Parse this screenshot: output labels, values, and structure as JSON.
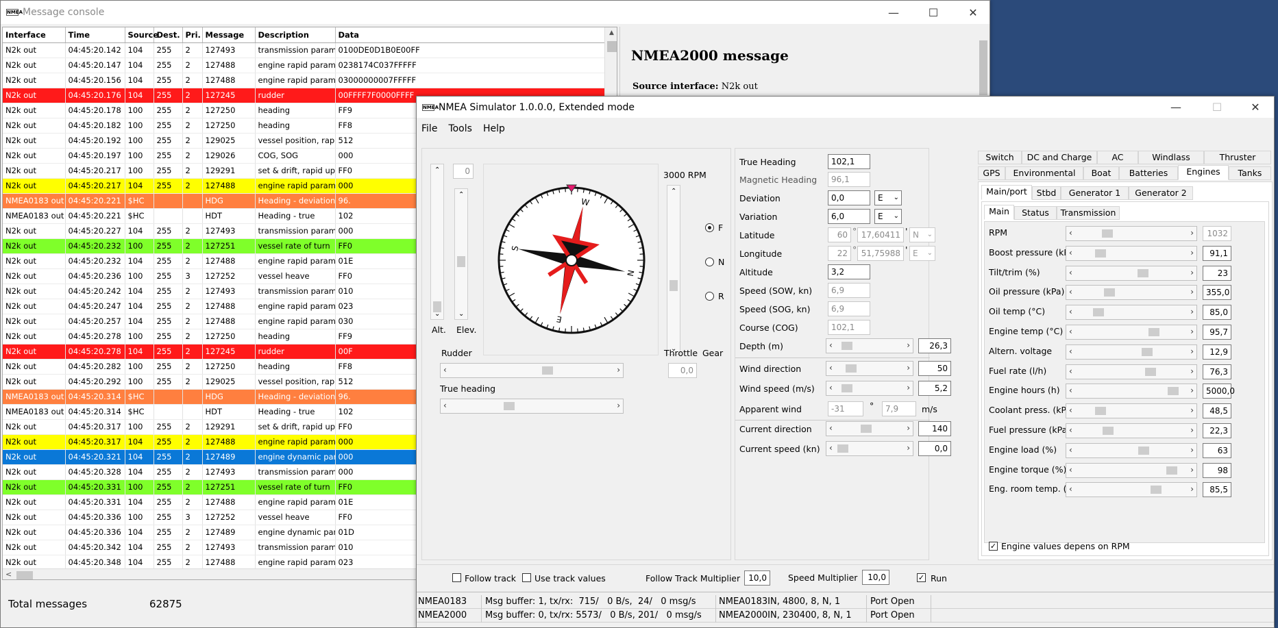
{
  "console": {
    "title": "Message console",
    "columns": [
      "Interface",
      "Time",
      "Source",
      "Dest.",
      "Pri.",
      "Message",
      "Description",
      "Data"
    ],
    "rows": [
      {
        "c": [
          "N2k out",
          "04:45:20.142",
          "104",
          "255",
          "2",
          "127493",
          "transmission parameter",
          "0100DE0D1B0E00FF"
        ],
        "hl": ""
      },
      {
        "c": [
          "N2k out",
          "04:45:20.147",
          "104",
          "255",
          "2",
          "127488",
          "engine rapid parameter",
          "0238174C037FFFFF"
        ],
        "hl": ""
      },
      {
        "c": [
          "N2k out",
          "04:45:20.156",
          "104",
          "255",
          "2",
          "127488",
          "engine rapid parameter",
          "03000000007FFFFF"
        ],
        "hl": ""
      },
      {
        "c": [
          "N2k out",
          "04:45:20.176",
          "104",
          "255",
          "2",
          "127245",
          "rudder",
          "00FFFF7F0000FFFF"
        ],
        "hl": "red"
      },
      {
        "c": [
          "N2k out",
          "04:45:20.178",
          "100",
          "255",
          "2",
          "127250",
          "heading",
          "FF9"
        ],
        "hl": ""
      },
      {
        "c": [
          "N2k out",
          "04:45:20.182",
          "100",
          "255",
          "2",
          "127250",
          "heading",
          "FF8"
        ],
        "hl": ""
      },
      {
        "c": [
          "N2k out",
          "04:45:20.192",
          "100",
          "255",
          "2",
          "129025",
          "vessel position, rapid up",
          "512"
        ],
        "hl": ""
      },
      {
        "c": [
          "N2k out",
          "04:45:20.197",
          "100",
          "255",
          "2",
          "129026",
          "COG, SOG",
          "000"
        ],
        "hl": ""
      },
      {
        "c": [
          "N2k out",
          "04:45:20.217",
          "100",
          "255",
          "2",
          "129291",
          "set & drift, rapid update",
          "FF0"
        ],
        "hl": ""
      },
      {
        "c": [
          "N2k out",
          "04:45:20.217",
          "104",
          "255",
          "2",
          "127488",
          "engine rapid parameter",
          "000"
        ],
        "hl": "yellow"
      },
      {
        "c": [
          "NMEA0183 out",
          "04:45:20.221",
          "$HC",
          "",
          "",
          "HDG",
          "Heading - deviation & va",
          "96."
        ],
        "hl": "orange"
      },
      {
        "c": [
          "NMEA0183 out",
          "04:45:20.221",
          "$HC",
          "",
          "",
          "HDT",
          "Heading - true",
          "102"
        ],
        "hl": ""
      },
      {
        "c": [
          "N2k out",
          "04:45:20.227",
          "104",
          "255",
          "2",
          "127493",
          "transmission parameter",
          "000"
        ],
        "hl": ""
      },
      {
        "c": [
          "N2k out",
          "04:45:20.232",
          "100",
          "255",
          "2",
          "127251",
          "vessel rate of turn",
          "FF0"
        ],
        "hl": "green"
      },
      {
        "c": [
          "N2k out",
          "04:45:20.232",
          "104",
          "255",
          "2",
          "127488",
          "engine rapid parameter",
          "01E"
        ],
        "hl": ""
      },
      {
        "c": [
          "N2k out",
          "04:45:20.236",
          "100",
          "255",
          "3",
          "127252",
          "vessel heave",
          "FF0"
        ],
        "hl": ""
      },
      {
        "c": [
          "N2k out",
          "04:45:20.242",
          "104",
          "255",
          "2",
          "127493",
          "transmission parameter",
          "010"
        ],
        "hl": ""
      },
      {
        "c": [
          "N2k out",
          "04:45:20.247",
          "104",
          "255",
          "2",
          "127488",
          "engine rapid parameter",
          "023"
        ],
        "hl": ""
      },
      {
        "c": [
          "N2k out",
          "04:45:20.257",
          "104",
          "255",
          "2",
          "127488",
          "engine rapid parameter",
          "030"
        ],
        "hl": ""
      },
      {
        "c": [
          "N2k out",
          "04:45:20.278",
          "100",
          "255",
          "2",
          "127250",
          "heading",
          "FF9"
        ],
        "hl": ""
      },
      {
        "c": [
          "N2k out",
          "04:45:20.278",
          "104",
          "255",
          "2",
          "127245",
          "rudder",
          "00F"
        ],
        "hl": "red"
      },
      {
        "c": [
          "N2k out",
          "04:45:20.282",
          "100",
          "255",
          "2",
          "127250",
          "heading",
          "FF8"
        ],
        "hl": ""
      },
      {
        "c": [
          "N2k out",
          "04:45:20.292",
          "100",
          "255",
          "2",
          "129025",
          "vessel position, rapid up",
          "512"
        ],
        "hl": ""
      },
      {
        "c": [
          "NMEA0183 out",
          "04:45:20.314",
          "$HC",
          "",
          "",
          "HDG",
          "Heading - deviation & va",
          "96."
        ],
        "hl": "orange"
      },
      {
        "c": [
          "NMEA0183 out",
          "04:45:20.314",
          "$HC",
          "",
          "",
          "HDT",
          "Heading - true",
          "102"
        ],
        "hl": ""
      },
      {
        "c": [
          "N2k out",
          "04:45:20.317",
          "100",
          "255",
          "2",
          "129291",
          "set & drift, rapid update",
          "FF0"
        ],
        "hl": ""
      },
      {
        "c": [
          "N2k out",
          "04:45:20.317",
          "104",
          "255",
          "2",
          "127488",
          "engine rapid parameter",
          "000"
        ],
        "hl": "yellow"
      },
      {
        "c": [
          "N2k out",
          "04:45:20.321",
          "104",
          "255",
          "2",
          "127489",
          "engine dynamic parame",
          "000"
        ],
        "hl": "blue"
      },
      {
        "c": [
          "N2k out",
          "04:45:20.328",
          "104",
          "255",
          "2",
          "127493",
          "transmission parameter",
          "000"
        ],
        "hl": ""
      },
      {
        "c": [
          "N2k out",
          "04:45:20.331",
          "100",
          "255",
          "2",
          "127251",
          "vessel rate of turn",
          "FF0"
        ],
        "hl": "green"
      },
      {
        "c": [
          "N2k out",
          "04:45:20.331",
          "104",
          "255",
          "2",
          "127488",
          "engine rapid parameter",
          "01E"
        ],
        "hl": ""
      },
      {
        "c": [
          "N2k out",
          "04:45:20.336",
          "100",
          "255",
          "3",
          "127252",
          "vessel heave",
          "FF0"
        ],
        "hl": ""
      },
      {
        "c": [
          "N2k out",
          "04:45:20.336",
          "104",
          "255",
          "2",
          "127489",
          "engine dynamic parame",
          "01D"
        ],
        "hl": ""
      },
      {
        "c": [
          "N2k out",
          "04:45:20.342",
          "104",
          "255",
          "2",
          "127493",
          "transmission parameter",
          "010"
        ],
        "hl": ""
      },
      {
        "c": [
          "N2k out",
          "04:45:20.348",
          "104",
          "255",
          "2",
          "127488",
          "engine rapid parameter",
          "023"
        ],
        "hl": ""
      }
    ],
    "total_label": "Total messages",
    "total_value": "62875",
    "detail_title": "NMEA2000 message",
    "detail_source_label": "Source interface:",
    "detail_source_value": "N2k out"
  },
  "sim": {
    "title": "NMEA Simulator 1.0.0.0, Extended mode",
    "menu": [
      "File",
      "Tools",
      "Help"
    ],
    "alt_value": "0",
    "alt_label": "Alt.",
    "elev_label": "Elev.",
    "rpm_label": "3000 RPM",
    "gear": [
      "F",
      "N",
      "R"
    ],
    "rudder_label": "Rudder",
    "throttle_label": "Throttle",
    "gear_label": "Gear",
    "throttle_value": "0,0",
    "true_heading_label": "True heading",
    "nav": {
      "true_heading": {
        "label": "True Heading",
        "value": "102,1"
      },
      "magnetic_heading": {
        "label": "Magnetic Heading",
        "value": "96,1"
      },
      "deviation": {
        "label": "Deviation",
        "value": "0,0",
        "dir": "E"
      },
      "variation": {
        "label": "Variation",
        "value": "6,0",
        "dir": "E"
      },
      "latitude": {
        "label": "Latitude",
        "deg": "60",
        "min": "17,60411",
        "dir": "N"
      },
      "longitude": {
        "label": "Longitude",
        "deg": "22",
        "min": "51,75988",
        "dir": "E"
      },
      "degree_sign": "°",
      "minute_sign": "'",
      "altitude": {
        "label": "Altitude",
        "value": "3,2"
      },
      "sow": {
        "label": "Speed (SOW, kn)",
        "value": "6,9"
      },
      "sog": {
        "label": "Speed (SOG, kn)",
        "value": "6,9"
      },
      "cog": {
        "label": "Course (COG)",
        "value": "102,1"
      },
      "depth": {
        "label": "Depth (m)",
        "value": "26,3"
      },
      "wind_dir": {
        "label": "Wind direction",
        "value": "50"
      },
      "wind_speed": {
        "label": "Wind speed (m/s)",
        "value": "5,2"
      },
      "apparent": {
        "label": "Apparent wind",
        "angle": "-31",
        "speed": "7,9",
        "unit": "m/s"
      },
      "current_dir": {
        "label": "Current direction",
        "value": "140"
      },
      "current_speed": {
        "label": "Current speed (kn)",
        "value": "0,0"
      }
    },
    "tabs_row1": [
      "Switch",
      "DC and Charge",
      "AC",
      "Windlass",
      "Thruster"
    ],
    "tabs_row2": [
      "GPS",
      "Environmental",
      "Boat",
      "Batteries",
      "Engines",
      "Tanks"
    ],
    "tabs_row3": [
      "Main/port",
      "Stbd",
      "Generator 1",
      "Generator 2"
    ],
    "tabs_row4": [
      "Main",
      "Status",
      "Transmission"
    ],
    "engine": [
      {
        "label": "RPM",
        "value": "1032",
        "level": 0.25
      },
      {
        "label": "Boost pressure (kPa)",
        "value": "91,1",
        "level": 0.18
      },
      {
        "label": "Tilt/trim (%)",
        "value": "23",
        "level": 0.61
      },
      {
        "label": "Oil pressure (kPa)",
        "value": "355,0",
        "level": 0.27
      },
      {
        "label": "Oil temp (°C)",
        "value": "85,0",
        "level": 0.16
      },
      {
        "label": "Engine temp (°C)",
        "value": "95,7",
        "level": 0.72
      },
      {
        "label": "Altern. voltage",
        "value": "12,9",
        "level": 0.65
      },
      {
        "label": "Fuel rate (l/h)",
        "value": "76,3",
        "level": 0.69
      },
      {
        "label": "Engine hours (h)",
        "value": "5000,0",
        "level": 0.92
      },
      {
        "label": "Coolant press. (kPa)",
        "value": "48,5",
        "level": 0.18
      },
      {
        "label": "Fuel pressure (kPa)",
        "value": "22,3",
        "level": 0.26
      },
      {
        "label": "Engine load (%)",
        "value": "63",
        "level": 0.62
      },
      {
        "label": "Engine torque (%)",
        "value": "98",
        "level": 0.9
      },
      {
        "label": "Eng. room temp. (°C",
        "value": "85,5",
        "level": 0.74
      }
    ],
    "engine_rpm_check": "Engine values depens on RPM",
    "follow_track": "Follow track",
    "use_track_values": "Use track values",
    "follow_mult_label": "Follow Track Multiplier",
    "follow_mult_value": "10,0",
    "speed_mult_label": "Speed Multiplier",
    "speed_mult_value": "10,0",
    "run_label": "Run",
    "ports": [
      {
        "name": "NMEA0183",
        "buffer": "Msg buffer: 1, tx/rx:  715/   0 B/s,  24/   0 msg/s",
        "cfg": "NMEA0183IN, 4800, 8, N, 1",
        "state": "Port Open"
      },
      {
        "name": "NMEA2000",
        "buffer": "Msg buffer: 0, tx/rx: 5573/   0 B/s, 201/   0 msg/s",
        "cfg": "NMEA2000IN, 230400, 8, N, 1",
        "state": "Port Open"
      }
    ]
  },
  "colors": {
    "red": "#ff1a1a",
    "yellow": "#ffff00",
    "orange": "#ff7f3f",
    "green": "#7fff2a",
    "blue": "#0a78d7"
  }
}
